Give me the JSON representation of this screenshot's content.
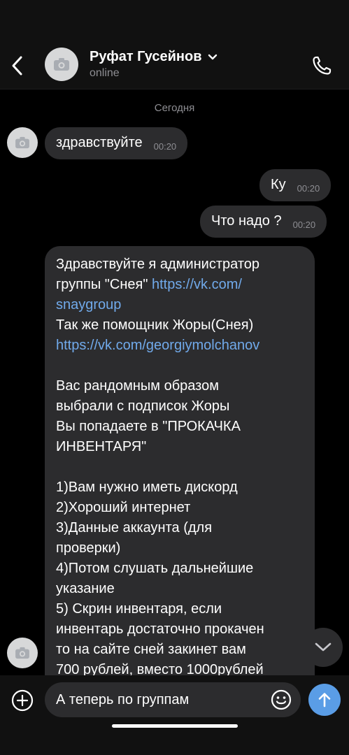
{
  "header": {
    "contact_name": "Руфат Гусейнов",
    "status": "online",
    "icons": [
      "back-icon",
      "camera-icon",
      "chevron-down-icon",
      "phone-icon"
    ]
  },
  "chat": {
    "date_separator": "Сегодня",
    "messages": [
      {
        "text": "здравствуйте",
        "time": "00:20",
        "side": "incoming"
      },
      {
        "text": "Ку",
        "time": "00:20",
        "side": "outgoing"
      },
      {
        "text": "Что надо ?",
        "time": "00:20",
        "side": "outgoing"
      },
      {
        "side": "incoming",
        "lines": [
          "Здравствуйте я администратор",
          "группы \"Снея\" ",
          "https://vk.com/",
          "snaygroup",
          "Так же помощник Жоры(Снея)",
          "https://vk.com/georgiymolchanov",
          "Вас рандомным образом",
          "выбрали с подписок Жоры",
          "Вы попадаете в \"ПРОКАЧКА",
          "ИНВЕНТАРЯ\"",
          "1)Вам нужно иметь дискорд",
          "2)Хороший интернет",
          "3)Данные аккаунта (для",
          "проверки)",
          "4)Потом слушать дальнейшие",
          "указание",
          "5) Скрин инвентаря, если",
          "инвентарь достаточно прокачен",
          "то на сайте сней закинет вам",
          "700 рублей, вместо 1000рублей"
        ]
      }
    ]
  },
  "composer": {
    "input_value": "А теперь по группам",
    "icons": [
      "plus-circle-icon",
      "emoji-icon",
      "send-arrow-icon"
    ]
  },
  "colors": {
    "background": "#000000",
    "bubble": "#2c2c2e",
    "link": "#71aaeb",
    "accent": "#5a9de6",
    "secondary_text": "#8e8e93"
  }
}
